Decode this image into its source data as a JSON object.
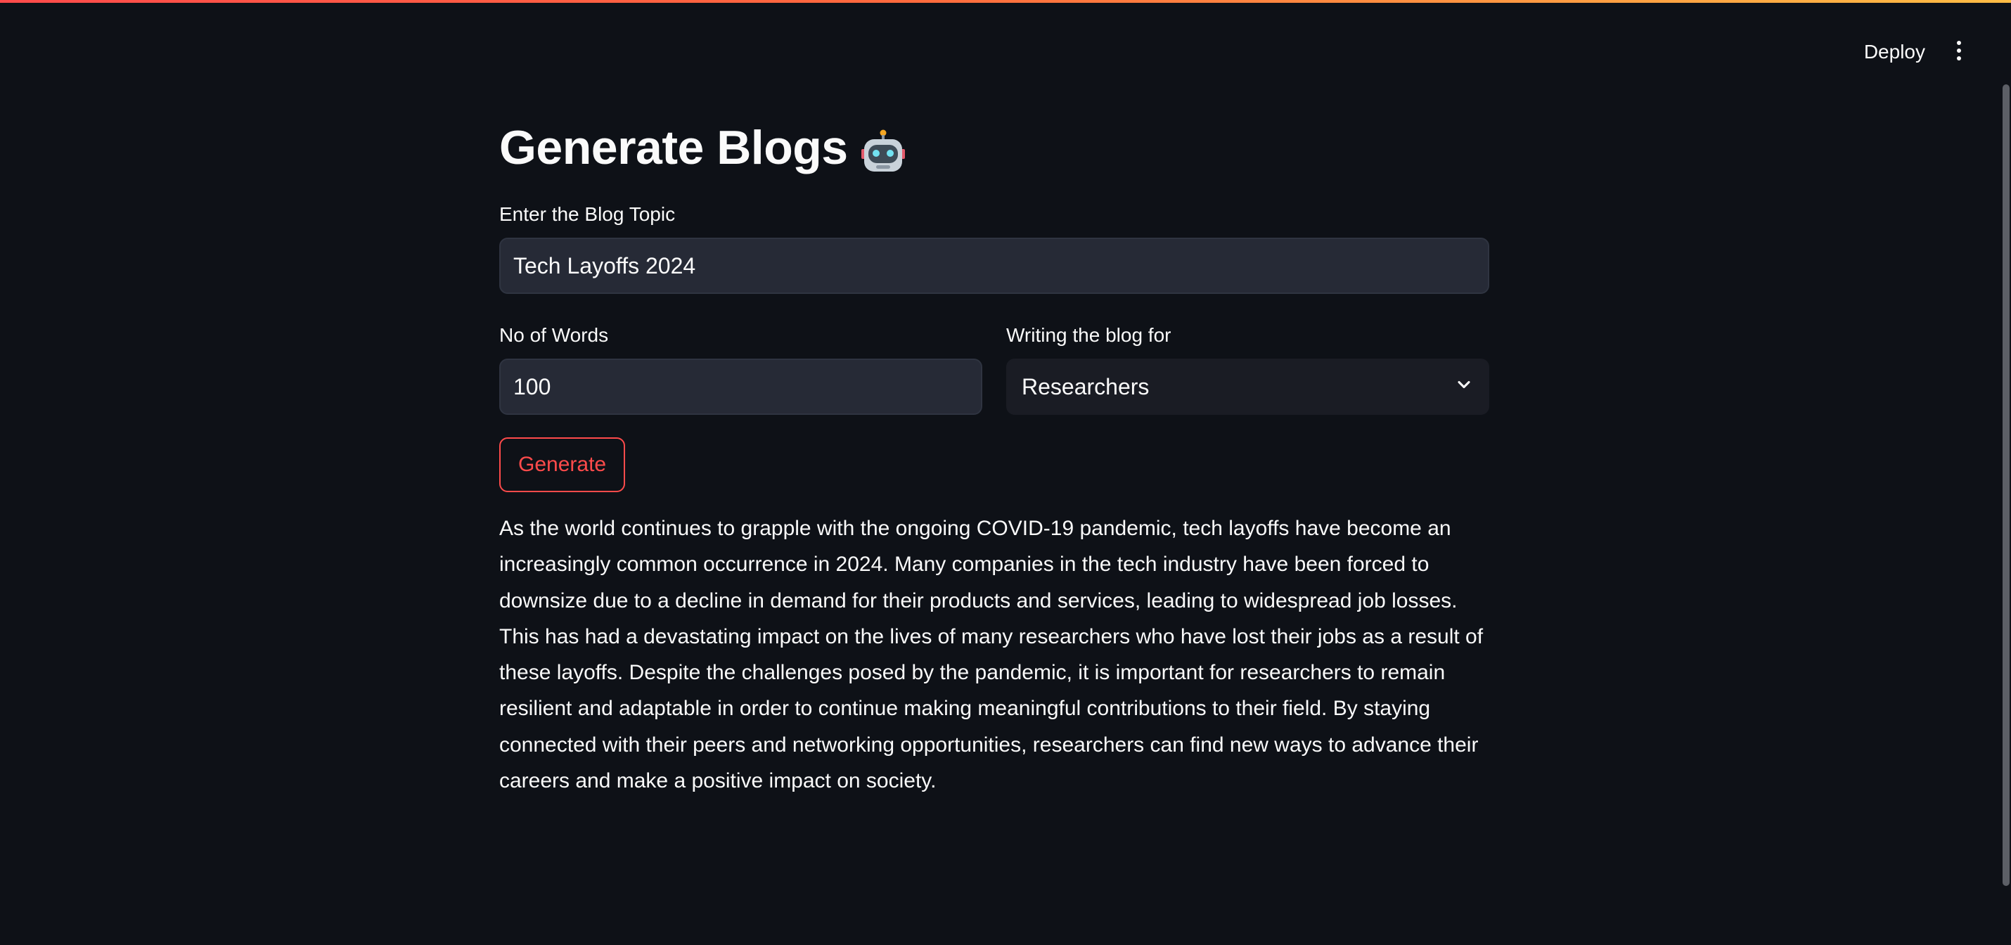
{
  "header": {
    "deploy_label": "Deploy",
    "menu_icon": "vertical-ellipsis-icon"
  },
  "main": {
    "title": "Generate Blogs",
    "title_icon": "robot-icon",
    "topic": {
      "label": "Enter the Blog Topic",
      "value": "Tech Layoffs 2024"
    },
    "words": {
      "label": "No of Words",
      "value": "100"
    },
    "audience": {
      "label": "Writing the blog for",
      "selected": "Researchers"
    },
    "generate_label": "Generate",
    "output": "As the world continues to grapple with the ongoing COVID-19 pandemic, tech layoffs have become an increasingly common occurrence in 2024. Many companies in the tech industry have been forced to downsize due to a decline in demand for their products and services, leading to widespread job losses. This has had a devastating impact on the lives of many researchers who have lost their jobs as a result of these layoffs. Despite the challenges posed by the pandemic, it is important for researchers to remain resilient and adaptable in order to continue making meaningful contributions to their field. By staying connected with their peers and networking opportunities, researchers can find new ways to advance their careers and make a positive impact on society."
  },
  "colors": {
    "background": "#0e1117",
    "input_background": "#262a36",
    "select_background": "#1a1c24",
    "accent": "#ff4b4b",
    "text": "#fafafa"
  }
}
